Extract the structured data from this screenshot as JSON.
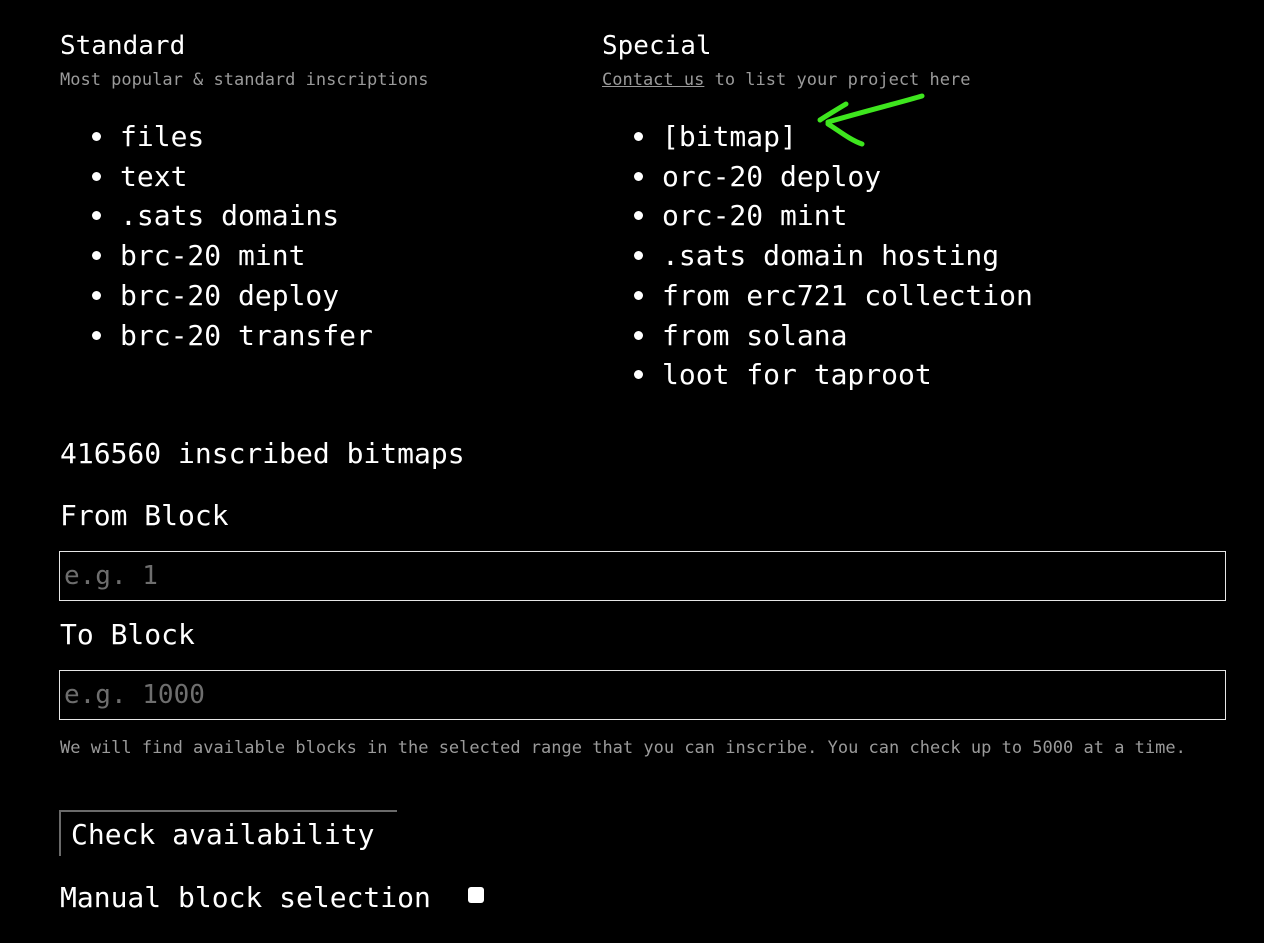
{
  "standard": {
    "title": "Standard",
    "subtitle": "Most popular & standard inscriptions",
    "items": [
      "files",
      "text",
      ".sats domains",
      "brc-20 mint",
      "brc-20 deploy",
      "brc-20 transfer"
    ]
  },
  "special": {
    "title": "Special",
    "contact_link": "Contact us",
    "subtitle_rest": " to list your project here",
    "items": [
      "[bitmap]",
      "orc-20 deploy",
      "orc-20 mint",
      ".sats domain hosting",
      "from erc721 collection",
      "from solana",
      "loot for taproot"
    ]
  },
  "inscribed_count": "416560 inscribed bitmaps",
  "from_block": {
    "label": "From Block",
    "placeholder": "e.g. 1",
    "value": ""
  },
  "to_block": {
    "label": "To Block",
    "placeholder": "e.g. 1000",
    "value": ""
  },
  "help_text": "We will find available blocks in the selected range that you can inscribe. You can check up to 5000 at a time.",
  "check_button_label": "Check availability",
  "manual_selection": {
    "label": "Manual block selection",
    "checked": false
  },
  "colors": {
    "background": "#000000",
    "text": "#ffffff",
    "muted": "#9a9a9a",
    "annotation_arrow": "#3ee61e"
  },
  "icons": {
    "annotation": "hand-drawn-arrow-icon",
    "bullet": "bullet-dot-icon"
  }
}
